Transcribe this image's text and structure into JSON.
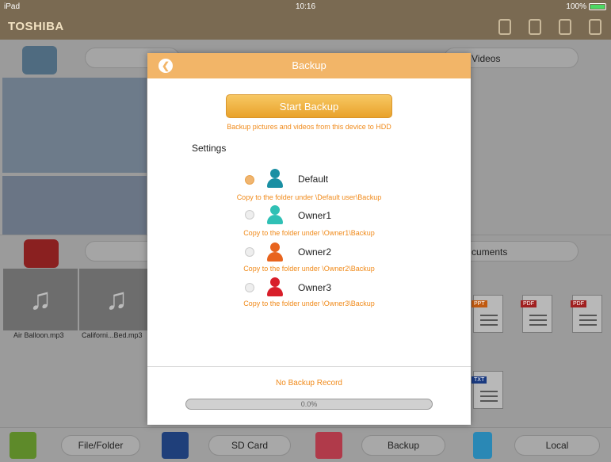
{
  "status": {
    "device": "iPad",
    "time": "10:16",
    "battery": "100%"
  },
  "app": {
    "brand": "TOSHIBA"
  },
  "background": {
    "videos_label": "Videos",
    "documents_label": "cuments",
    "files": [
      "Air Balloon.mp3",
      "Californi...Bed.mp3"
    ],
    "doc_tags": [
      "PPT",
      "PDF",
      "PDF",
      "TXT"
    ]
  },
  "tabbar": {
    "tabs": [
      {
        "label": "File/Folder",
        "icon": "folder-icon"
      },
      {
        "label": "SD Card",
        "icon": "sd-card-icon"
      },
      {
        "label": "Backup",
        "icon": "backup-icon"
      },
      {
        "label": "Local",
        "icon": "phone-icon"
      }
    ]
  },
  "modal": {
    "title": "Backup",
    "back_glyph": "❮",
    "start_button": "Start Backup",
    "start_hint": "Backup pictures and videos from this device to HDD",
    "settings_label": "Settings",
    "users": [
      {
        "name": "Default",
        "hint": "Copy to the folder under \\Default user\\Backup",
        "selected": true,
        "color": "#1a8fa3"
      },
      {
        "name": "Owner1",
        "hint": "Copy to the folder under \\Owner1\\Backup",
        "selected": false,
        "color": "#2fc0b5"
      },
      {
        "name": "Owner2",
        "hint": "Copy to the folder under \\Owner2\\Backup",
        "selected": false,
        "color": "#e8641e"
      },
      {
        "name": "Owner3",
        "hint": "Copy to the folder under \\Owner3\\Backup",
        "selected": false,
        "color": "#d81e2a"
      }
    ],
    "record_text": "No Backup Record",
    "progress_text": "0.0%",
    "progress_fraction": 0
  },
  "colors": {
    "accent": "#f2b568",
    "hint": "#f08a1a"
  }
}
